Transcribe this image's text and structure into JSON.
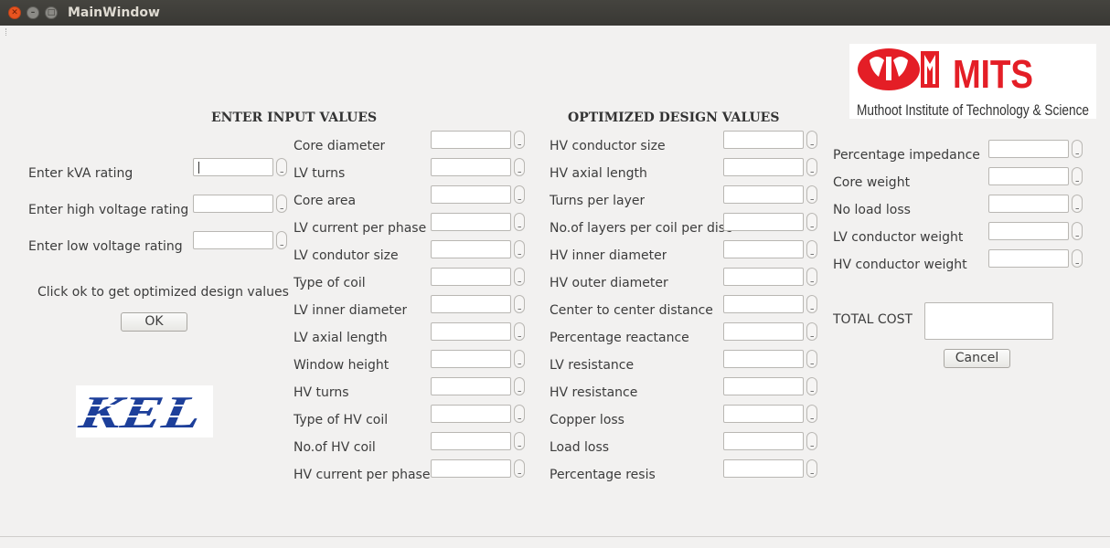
{
  "window": {
    "title": "MainWindow"
  },
  "headings": {
    "input": "ENTER INPUT VALUES",
    "output": "OPTIMIZED DESIGN VALUES"
  },
  "inputs": [
    {
      "label": "Enter kVA rating",
      "value": ""
    },
    {
      "label": "Enter high voltage rating",
      "value": ""
    },
    {
      "label": "Enter low voltage rating",
      "value": ""
    }
  ],
  "instruction": "Click ok to get optimized design values",
  "buttons": {
    "ok": "OK",
    "cancel": "Cancel"
  },
  "column1": [
    "Core diameter",
    "LV turns",
    "Core area",
    "LV current per phase",
    "LV condutor size",
    "Type of coil",
    "LV inner diameter",
    "LV axial length",
    "Window height",
    "HV turns",
    "Type of HV coil",
    "No.of HV coil",
    "HV current per phase"
  ],
  "column2": [
    "HV conductor size",
    "HV axial length",
    "Turns per layer",
    "No.of layers per coil per disc",
    "HV inner diameter",
    "HV outer diameter",
    "Center to center distance",
    "Percentage reactance",
    "LV resistance",
    "HV resistance",
    "Copper loss",
    "Load loss",
    "Percentage resis"
  ],
  "column3": [
    "Percentage impedance",
    "Core weight",
    "No load loss",
    "LV conductor weight",
    "HV conductor weight"
  ],
  "total_cost": {
    "label": "TOTAL COST",
    "value": ""
  },
  "logos": {
    "mits": {
      "name": "MITS",
      "subtitle": "Muthoot Institute of Technology & Science",
      "color": "#e41e26"
    },
    "kel": {
      "name": "KEL",
      "color": "#1d3f9a"
    }
  }
}
